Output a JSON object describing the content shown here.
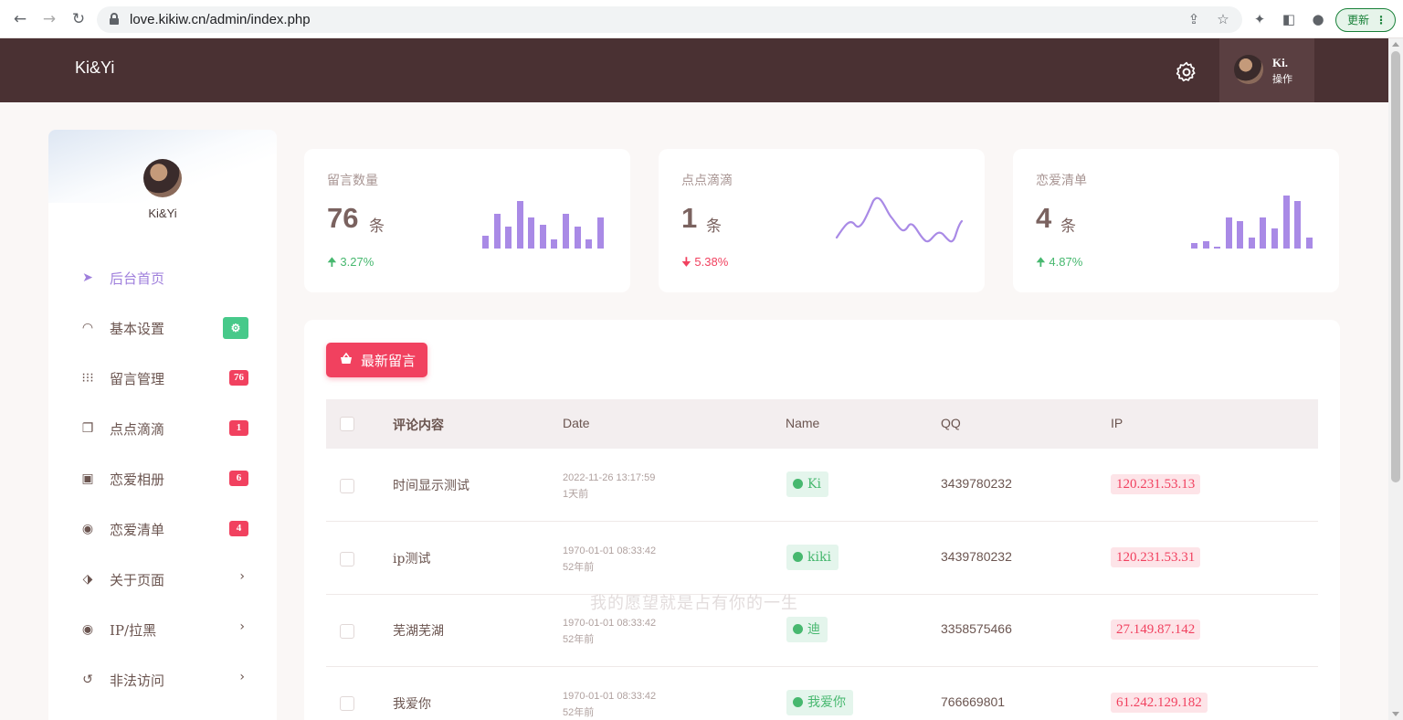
{
  "browser": {
    "url": "love.kikiw.cn/admin/index.php",
    "update_label": "更新"
  },
  "header": {
    "brand": "Ki&Yi",
    "user_name": "Ki.",
    "user_action": "操作"
  },
  "sidebar": {
    "name": "Ki&Yi",
    "items": [
      {
        "label": "后台首页",
        "icon": "send-icon",
        "active": true
      },
      {
        "label": "基本设置",
        "icon": "speedometer-icon",
        "badge": "gear"
      },
      {
        "label": "留言管理",
        "icon": "grid-dots-icon",
        "badge": "76"
      },
      {
        "label": "点点滴滴",
        "icon": "files-icon",
        "badge": "1"
      },
      {
        "label": "恋爱相册",
        "icon": "album-icon",
        "badge": "6"
      },
      {
        "label": "恋爱清单",
        "icon": "location-pin-icon",
        "badge": "4"
      },
      {
        "label": "关于页面",
        "icon": "tags-icon",
        "chevron": true
      },
      {
        "label": "IP/拉黑",
        "icon": "location-pin-icon",
        "chevron": true
      },
      {
        "label": "非法访问",
        "icon": "history-icon",
        "chevron": true
      }
    ]
  },
  "stats": [
    {
      "title": "留言数量",
      "value": "76",
      "unit": "条",
      "change": "3.27%",
      "trend": "up",
      "chart": "bar"
    },
    {
      "title": "点点滴滴",
      "value": "1",
      "unit": "条",
      "change": "5.38%",
      "trend": "down",
      "chart": "line"
    },
    {
      "title": "恋爱清单",
      "value": "4",
      "unit": "条",
      "change": "4.87%",
      "trend": "up",
      "chart": "bar"
    }
  ],
  "colors": {
    "header_bg": "#4a3133",
    "accent": "#9f7fdc",
    "danger": "#f1415f",
    "success": "#47b86f"
  },
  "table": {
    "button_label": "最新留言",
    "headers": {
      "content": "评论内容",
      "date": "Date",
      "name": "Name",
      "qq": "QQ",
      "ip": "IP"
    },
    "rows": [
      {
        "content": "时间显示测试",
        "date": "2022-11-26 13:17:59",
        "ago": "1天前",
        "name": "Ki",
        "qq": "3439780232",
        "ip": "120.231.53.13"
      },
      {
        "content": "ip测试",
        "date": "1970-01-01 08:33:42",
        "ago": "52年前",
        "name": "kiki",
        "qq": "3439780232",
        "ip": "120.231.53.31"
      },
      {
        "content": "芜湖芜湖",
        "date": "1970-01-01 08:33:42",
        "ago": "52年前",
        "name": "迪",
        "qq": "3358575466",
        "ip": "27.149.87.142"
      },
      {
        "content": "我爱你",
        "date": "1970-01-01 08:33:42",
        "ago": "52年前",
        "name": "我爱你",
        "qq": "766669801",
        "ip": "61.242.129.182"
      }
    ]
  },
  "watermark": "我的愿望就是占有你的一生"
}
